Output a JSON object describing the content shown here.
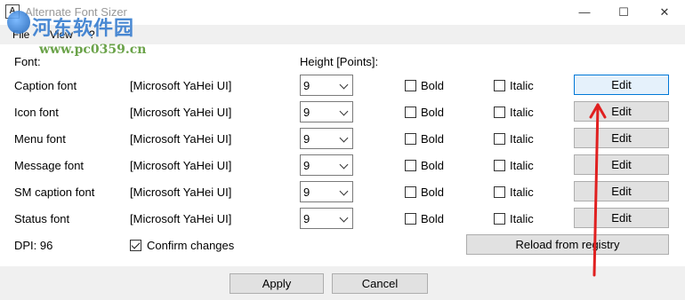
{
  "window": {
    "title": "Alternate Font Sizer",
    "app_icon_text": "A",
    "controls": {
      "minimize": "—",
      "maximize": "☐",
      "close": "✕"
    }
  },
  "watermark": {
    "main": "河东软件园",
    "url": "www.pc0359.cn"
  },
  "menu": {
    "file": "File",
    "view": "View",
    "help": "?"
  },
  "headers": {
    "font": "Font:",
    "height": "Height [Points]:"
  },
  "rows": [
    {
      "label": "Caption font",
      "font": "[Microsoft YaHei UI]",
      "size": "9",
      "bold": "Bold",
      "italic": "Italic",
      "edit": "Edit"
    },
    {
      "label": "Icon font",
      "font": "[Microsoft YaHei UI]",
      "size": "9",
      "bold": "Bold",
      "italic": "Italic",
      "edit": "Edit"
    },
    {
      "label": "Menu font",
      "font": "[Microsoft YaHei UI]",
      "size": "9",
      "bold": "Bold",
      "italic": "Italic",
      "edit": "Edit"
    },
    {
      "label": "Message font",
      "font": "[Microsoft YaHei UI]",
      "size": "9",
      "bold": "Bold",
      "italic": "Italic",
      "edit": "Edit"
    },
    {
      "label": "SM caption font",
      "font": "[Microsoft YaHei UI]",
      "size": "9",
      "bold": "Bold",
      "italic": "Italic",
      "edit": "Edit"
    },
    {
      "label": "Status font",
      "font": "[Microsoft YaHei UI]",
      "size": "9",
      "bold": "Bold",
      "italic": "Italic",
      "edit": "Edit"
    }
  ],
  "dpi_label": "DPI: 96",
  "confirm_changes": {
    "label": "Confirm changes",
    "checked": true
  },
  "reload_button": "Reload from registry",
  "apply_button": "Apply",
  "cancel_button": "Cancel",
  "accent_color": "#0078d7",
  "annotation_arrow_color": "#e02020"
}
